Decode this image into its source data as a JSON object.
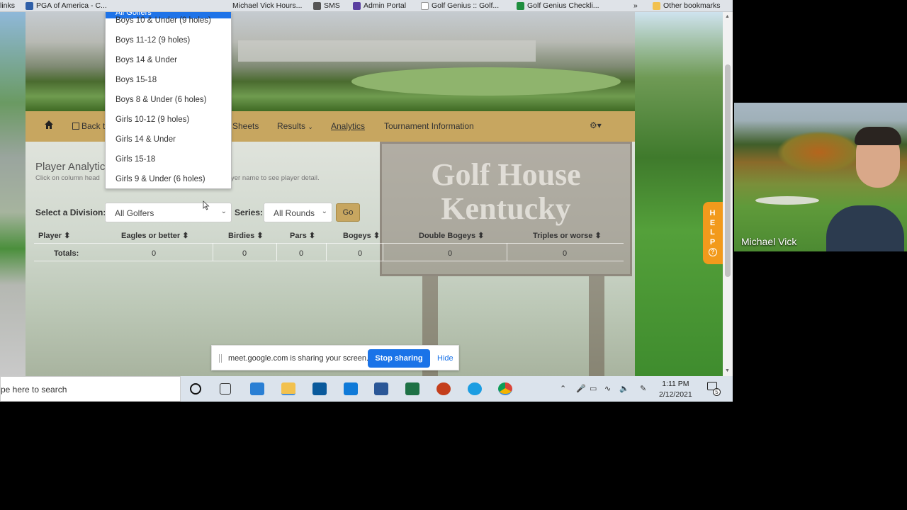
{
  "bookmarks": [
    {
      "label": "links",
      "color": ""
    },
    {
      "label": "PGA of America - C...",
      "color": "#2f5fa8"
    },
    {
      "label": "Michael Vick Hours...",
      "color": ""
    },
    {
      "label": "SMS",
      "color": "#555555"
    },
    {
      "label": "Admin Portal",
      "color": "#5a3fa0"
    },
    {
      "label": "Golf Genius :: Golf...",
      "color": "#ffffff"
    },
    {
      "label": "Golf Genius Checkli...",
      "color": "#1e8e3e"
    },
    {
      "label": "»",
      "color": ""
    },
    {
      "label": "Other bookmarks",
      "color": "#f2c14e"
    }
  ],
  "nav": {
    "home_icon": "home-icon",
    "back_label": "Back t",
    "sheets_label": "Sheets",
    "results_label": "Results",
    "analytics_label": "Analytics",
    "tournament_info_label": "Tournament Information",
    "settings_icon": "gear-icon"
  },
  "sign": {
    "line1": "Golf House",
    "line2": "Kentucky"
  },
  "page": {
    "title": "Player Analytic",
    "hint_left": "Click on column head",
    "hint_right": "yer name to see player detail."
  },
  "filters": {
    "division_label": "Select a Division:",
    "division_value": "All Golfers",
    "series_label": "Series:",
    "series_value": "All Rounds",
    "go_label": "Go"
  },
  "dropdown": {
    "selected": "All Golfers",
    "options": [
      "Boys 10 & Under (9 holes)",
      "Boys 11-12 (9 holes)",
      "Boys 14 & Under",
      "Boys 15-18",
      "Boys 8 & Under (6 holes)",
      "Girls 10-12 (9 holes)",
      "Girls 14 & Under",
      "Girls 15-18",
      "Girls 9 & Under (6 holes)"
    ]
  },
  "table": {
    "headers": [
      "Player",
      "Eagles or better",
      "Birdies",
      "Pars",
      "Bogeys",
      "Double Bogeys",
      "Triples or worse"
    ],
    "totals_label": "Totals:",
    "totals": [
      "0",
      "0",
      "0",
      "0",
      "0",
      "0"
    ]
  },
  "help": {
    "letters": [
      "H",
      "E",
      "L",
      "P"
    ],
    "icon": "question-icon"
  },
  "share_bar": {
    "message": "meet.google.com is sharing your screen.",
    "stop_label": "Stop sharing",
    "hide_label": "Hide"
  },
  "taskbar": {
    "search_placeholder": "pe here to search",
    "time": "1:11 PM",
    "date": "2/12/2021",
    "notification_count": "5"
  },
  "webcam": {
    "name": "Michael Vick"
  }
}
